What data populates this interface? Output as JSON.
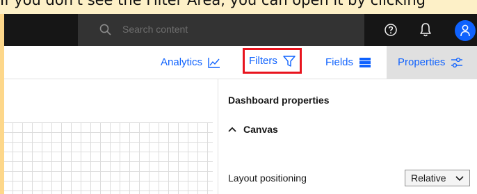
{
  "instruction_text": "If you don't see the Filter Area, you can open it by clicking",
  "search": {
    "placeholder": "Search content"
  },
  "toolbar": {
    "analytics_label": "Analytics",
    "filters_label": "Filters",
    "fields_label": "Fields",
    "properties_label": "Properties"
  },
  "panel": {
    "title": "Dashboard properties",
    "section_label": "Canvas",
    "layout_label": "Layout positioning",
    "layout_value": "Relative"
  },
  "icons": {
    "search": "search-icon",
    "help": "help-icon",
    "notification": "bell-icon",
    "user": "user-icon",
    "analytics": "chart-line-icon",
    "filters": "filter-icon",
    "fields": "fields-icon",
    "properties": "sliders-icon",
    "collapse": "chevron-up-icon",
    "dropdown": "chevron-down-icon"
  },
  "colors": {
    "accent": "#0f62fe",
    "highlight": "#e8141e",
    "header_bg": "#161616",
    "note_bg": "#fdf0c7"
  }
}
